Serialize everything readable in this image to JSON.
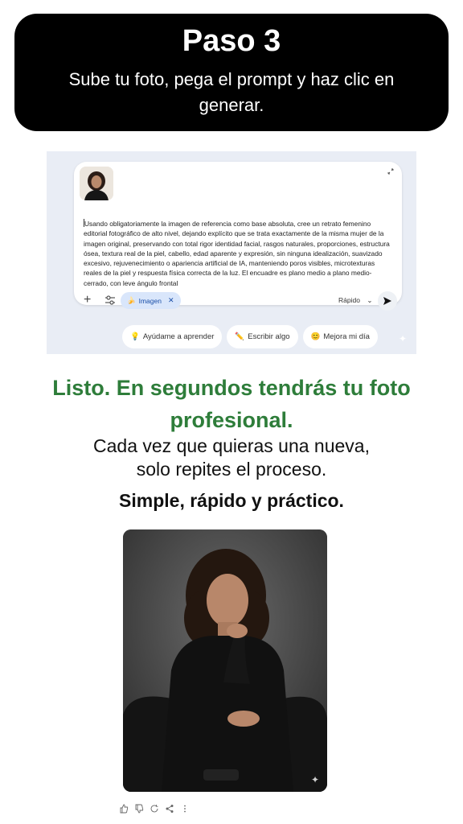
{
  "step": {
    "title": "Paso 3",
    "subtitle": "Sube tu foto, pega el prompt y haz clic en generar."
  },
  "chat": {
    "prompt_text": "Usando obligatoriamente la imagen de referencia como base absoluta, cree un retrato femenino editorial fotográfico de alto nivel, dejando explícito que se trata exactamente de la misma mujer de la imagen original, preservando con total rigor identidad facial, rasgos naturales, proporciones, estructura ósea, textura real de la piel, cabello, edad aparente y expresión, sin ninguna idealización, suavizado excesivo, rejuvenecimiento o apariencia artificial de IA, manteniendo poros visibles, microtexturas reales de la piel y respuesta física correcta de la luz. El encuadre es plano medio a plano medio-cerrado, con leve ángulo frontal",
    "chip_label": "Imagen",
    "mode_label": "Rápido",
    "suggestions": [
      {
        "icon": "lightbulb-icon",
        "label": "Ayúdame a aprender"
      },
      {
        "icon": "pencil-icon",
        "label": "Escribir algo"
      },
      {
        "icon": "smile-icon",
        "label": "Mejora mi día"
      }
    ]
  },
  "result": {
    "headline": "Listo. En segundos tendrás tu foto profesional.",
    "line1": "Cada vez que quieras una nueva,",
    "line2": "solo repites el proceso.",
    "emphasis": "Simple, rápido y práctico."
  },
  "colors": {
    "headline_green": "#2e7d3a",
    "chip_bg": "#d9e6fb",
    "panel_bg": "#e9edf5"
  }
}
